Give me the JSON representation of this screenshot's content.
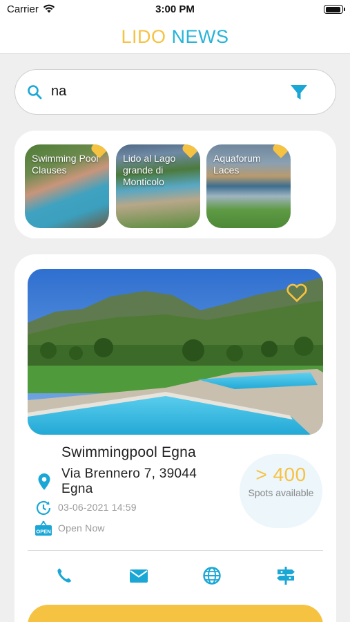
{
  "status_bar": {
    "carrier": "Carrier",
    "time": "3:00 PM"
  },
  "header": {
    "title_part1": "LIDO",
    "title_part2": "NEWS"
  },
  "search": {
    "query": "na"
  },
  "favorites": [
    {
      "name": "Swimming Pool Clauses"
    },
    {
      "name": "Lido al Lago grande di Monticolo"
    },
    {
      "name": "Aquaforum Laces"
    }
  ],
  "pool": {
    "name": "Swimmingpool Egna",
    "address": "Via Brennero 7,  39044 Egna",
    "updated": "03-06-2021 14:59",
    "open_status": "Open Now",
    "spots_value": "> 400",
    "spots_label": "Spots available",
    "open_badge": "OPEN"
  },
  "colors": {
    "accent_yellow": "#f6c242",
    "accent_blue": "#26b4d8",
    "icon_blue": "#1ba7d6"
  },
  "icons": [
    "wifi-icon",
    "battery-icon",
    "search-icon",
    "filter-icon",
    "heart-icon",
    "location-pin-icon",
    "clock-icon",
    "open-sign-icon",
    "phone-icon",
    "mail-icon",
    "globe-icon",
    "signpost-icon"
  ]
}
